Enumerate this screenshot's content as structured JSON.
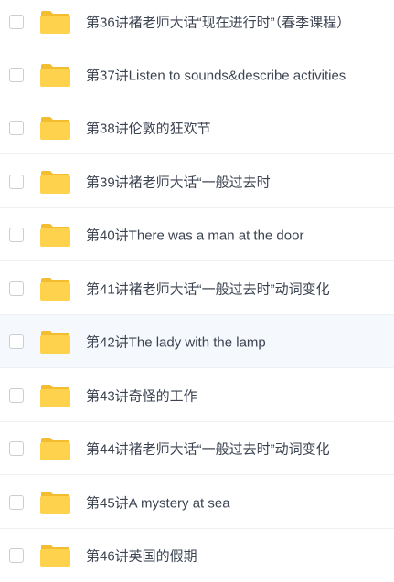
{
  "colors": {
    "folder": "#ffd24d",
    "folder_dark": "#f4bd2f",
    "text": "#3c4351",
    "highlight_row": "#f5f8fc",
    "divider": "#eef0f4"
  },
  "files": [
    {
      "name": "第36讲褚老师大话“现在进行时”（春季课程）",
      "icon": "folder-icon"
    },
    {
      "name": "第37讲Listen to sounds&describe activities",
      "icon": "folder-icon"
    },
    {
      "name": "第38讲伦敦的狂欢节",
      "icon": "folder-icon"
    },
    {
      "name": "第39讲褚老师大话“一般过去时",
      "icon": "folder-icon"
    },
    {
      "name": "第40讲There was a man at the door",
      "icon": "folder-icon"
    },
    {
      "name": "第41讲褚老师大话“一般过去时”动词变化",
      "icon": "folder-icon"
    },
    {
      "name": "第42讲The lady with the lamp",
      "icon": "folder-icon"
    },
    {
      "name": "第43讲奇怪的工作",
      "icon": "folder-icon"
    },
    {
      "name": "第44讲褚老师大话“一般过去时”动词变化",
      "icon": "folder-icon"
    },
    {
      "name": "第45讲A mystery at sea",
      "icon": "folder-icon"
    },
    {
      "name": "第46讲英国的假期",
      "icon": "folder-icon"
    }
  ]
}
